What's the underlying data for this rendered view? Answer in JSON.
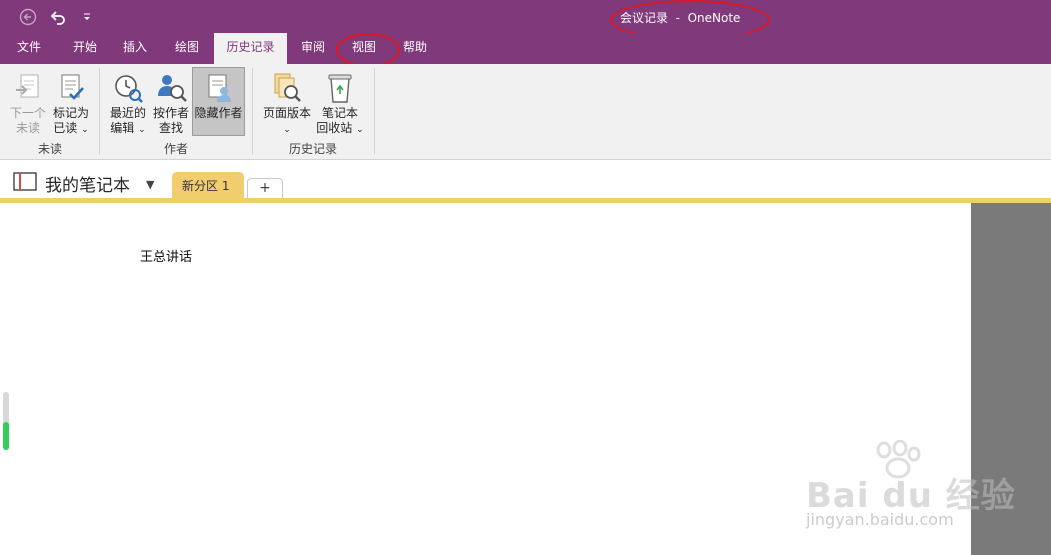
{
  "app": {
    "title": "会议记录  -  OneNote"
  },
  "quick_access": {
    "back_icon": "back-circle-icon",
    "undo_icon": "undo-icon",
    "customize_icon": "customize-toolbar-icon"
  },
  "tabs": [
    {
      "label": "文件"
    },
    {
      "label": "开始"
    },
    {
      "label": "插入"
    },
    {
      "label": "绘图"
    },
    {
      "label": "历史记录"
    },
    {
      "label": "审阅"
    },
    {
      "label": "视图"
    },
    {
      "label": "帮助"
    }
  ],
  "active_tab": "历史记录",
  "ribbon": {
    "groups": [
      {
        "label": "未读"
      },
      {
        "label": "作者"
      },
      {
        "label": "历史记录"
      }
    ],
    "buttons": {
      "next_unread": {
        "line1": "下一个",
        "line2": "未读"
      },
      "mark_read": {
        "line1": "标记为",
        "line2": "已读"
      },
      "recent_edits": {
        "line1": "最近的",
        "line2": "编辑"
      },
      "find_by_author": {
        "line1": "按作者",
        "line2": "查找"
      },
      "hide_authors": {
        "line1": "隐藏作者"
      },
      "page_versions": {
        "line1": "页面版本"
      },
      "recycle_bin": {
        "line1": "笔记本",
        "line2": "回收站"
      }
    }
  },
  "notebook": {
    "name": "我的笔记本",
    "section": "新分区 1",
    "add_section": "+"
  },
  "page": {
    "content": "王总讲话"
  },
  "watermark": {
    "brand": "Bai du 经验",
    "url": "jingyan.baidu.com"
  },
  "colors": {
    "accent": "#80397b",
    "section_tab": "#f2cd6e",
    "annotation_ring": "#e0181e"
  }
}
